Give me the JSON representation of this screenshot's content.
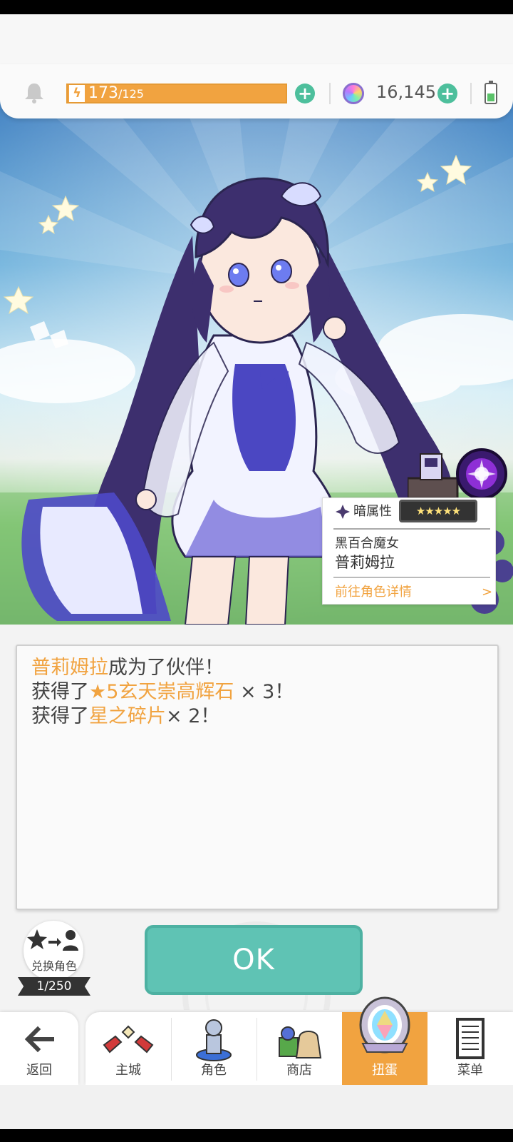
{
  "header": {
    "stamina_current": "173",
    "stamina_max": "/125",
    "gem_count": "16,145",
    "colors": {
      "stamina": "#f1a340",
      "plus": "#4dbf9c"
    }
  },
  "character_card": {
    "attribute": "暗属性",
    "rarity_stars": "★★★★★",
    "title": "黑百合魔女",
    "name": "普莉姆拉",
    "detail_link": "前往角色详情",
    "detail_arrow": ">"
  },
  "message": {
    "line1": {
      "name": "普莉姆拉",
      "rest": "成为了伙伴！"
    },
    "line2": {
      "prefix": "获得了",
      "item": "★5玄天崇高辉石",
      "suffix": " × 3！"
    },
    "line3": {
      "prefix": "获得了",
      "item": "星之碎片",
      "suffix": "× 2！"
    }
  },
  "exchange": {
    "label": "兑换角色",
    "count": "1/250"
  },
  "ok_button": {
    "label": "OK",
    "color": "#5fc3b4"
  },
  "nav": {
    "back": {
      "label": "返回",
      "icon": "arrow-left-icon"
    },
    "items": [
      {
        "label": "主城",
        "icon": "castle-icon"
      },
      {
        "label": "角色",
        "icon": "character-icon"
      },
      {
        "label": "商店",
        "icon": "shop-bag-icon"
      },
      {
        "label": "扭蛋",
        "icon": "gacha-crystal-icon",
        "active": true
      },
      {
        "label": "菜单",
        "icon": "menu-list-icon"
      }
    ],
    "active_color": "#f1a340"
  }
}
